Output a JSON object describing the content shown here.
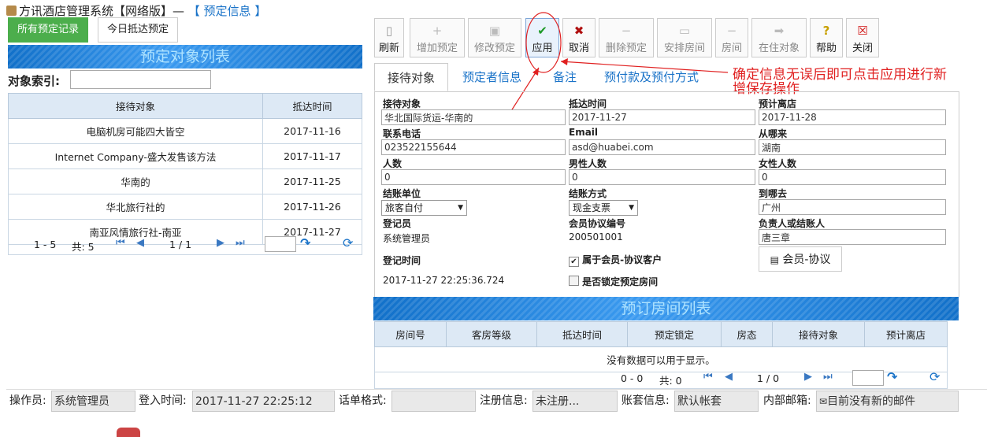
{
  "app": {
    "title": "方讯酒店管理系统【网络版】— ",
    "module": "【 预定信息 】"
  },
  "left": {
    "tabs": [
      "所有预定记录",
      "今日抵达预定"
    ],
    "banner": "预定对象列表",
    "search_label": "对象索引:",
    "search_value": "",
    "columns": [
      "接待对象",
      "抵达时间"
    ],
    "rows": [
      [
        "电脑机房可能四大皆空",
        "2017-11-16"
      ],
      [
        "Internet Company-盛大发售该方法",
        "2017-11-17"
      ],
      [
        "华南的",
        "2017-11-25"
      ],
      [
        "华北旅行社的",
        "2017-11-26"
      ],
      [
        "南亚风情旅行社-南亚",
        "2017-11-27"
      ]
    ],
    "pager": {
      "range": "1 - 5",
      "total": "共: 5",
      "page": "1 / 1"
    }
  },
  "toolbar": {
    "buttons": [
      {
        "label": "刷新",
        "icon": "refresh-icon",
        "enabled": true
      },
      {
        "label": "增加预定",
        "icon": "plus-icon",
        "enabled": false
      },
      {
        "label": "修改预定",
        "icon": "edit-icon",
        "enabled": false
      },
      {
        "label": "应用",
        "icon": "check-icon",
        "enabled": true
      },
      {
        "label": "取消",
        "icon": "x-icon",
        "enabled": true
      },
      {
        "label": "删除预定",
        "icon": "minus-icon",
        "enabled": false
      },
      {
        "label": "安排房间",
        "icon": "bed-icon",
        "enabled": false
      },
      {
        "label": "房间",
        "icon": "minus-icon",
        "enabled": false
      },
      {
        "label": "在住对象",
        "icon": "arrow-right-icon",
        "enabled": false
      },
      {
        "label": "帮助",
        "icon": "help-icon",
        "enabled": true
      },
      {
        "label": "关闭",
        "icon": "close-icon",
        "enabled": true
      }
    ]
  },
  "annotation": {
    "line1": "确定信息无误后即可点击应用进行新",
    "line2": "增保存操作"
  },
  "detail_tabs": [
    "接待对象",
    "预定者信息",
    "备注",
    "预付款及预付方式"
  ],
  "form": {
    "guest_label": "接待对象",
    "guest_value": "华北国际货运-华南的",
    "arrival_label": "抵达时间",
    "arrival_value": "2017-11-27",
    "departure_label": "预计离店",
    "departure_value": "2017-11-28",
    "phone_label": "联系电话",
    "phone_value": "023522155644",
    "email_label": "Email",
    "email_value": "asd@huabei.com",
    "from_label": "从哪来",
    "from_value": "湖南",
    "people_label": "人数",
    "people_value": "0",
    "male_label": "男性人数",
    "male_value": "0",
    "female_label": "女性人数",
    "female_value": "0",
    "billing_unit_label": "结账单位",
    "billing_unit_value": "旅客自付",
    "pay_method_label": "结账方式",
    "pay_method_value": "现金支票",
    "to_label": "到哪去",
    "to_value": "广州",
    "registrar_label": "登记员",
    "registrar_value": "系统管理员",
    "member_no_label": "会员协议编号",
    "member_no_value": "200501001",
    "responsible_label": "负责人或结账人",
    "responsible_value": "唐三章",
    "reg_time_label": "登记时间",
    "reg_time_value": "2017-11-27 22:25:36.724",
    "member_check_label": "属于会员-协议客户",
    "member_checked": true,
    "lock_check_label": "是否锁定预定房间",
    "lock_checked": false,
    "member_button": "会员-协议"
  },
  "rooms": {
    "banner": "预订房间列表",
    "columns": [
      "房间号",
      "客房等级",
      "抵达时间",
      "预定锁定",
      "房态",
      "接待对象",
      "预计离店"
    ],
    "empty": "没有数据可以用于显示。",
    "pager": {
      "range": "0 - 0",
      "total": "共: 0",
      "page": "1 / 0"
    }
  },
  "status": {
    "operator_label": "操作员:",
    "operator_value": "系统管理员",
    "login_label": "登入时间:",
    "login_value": "2017-11-27 22:25:12",
    "format_label": "话单格式:",
    "format_value": "",
    "reg_label": "注册信息:",
    "reg_value": "未注册...",
    "account_label": "账套信息:",
    "account_value": "默认帐套",
    "mail_label": "内部邮箱:",
    "mail_value": "目前没有新的邮件"
  },
  "colors": {
    "accent": "#1a73c8",
    "green": "#4cae4c",
    "annotation": "#e02020"
  }
}
